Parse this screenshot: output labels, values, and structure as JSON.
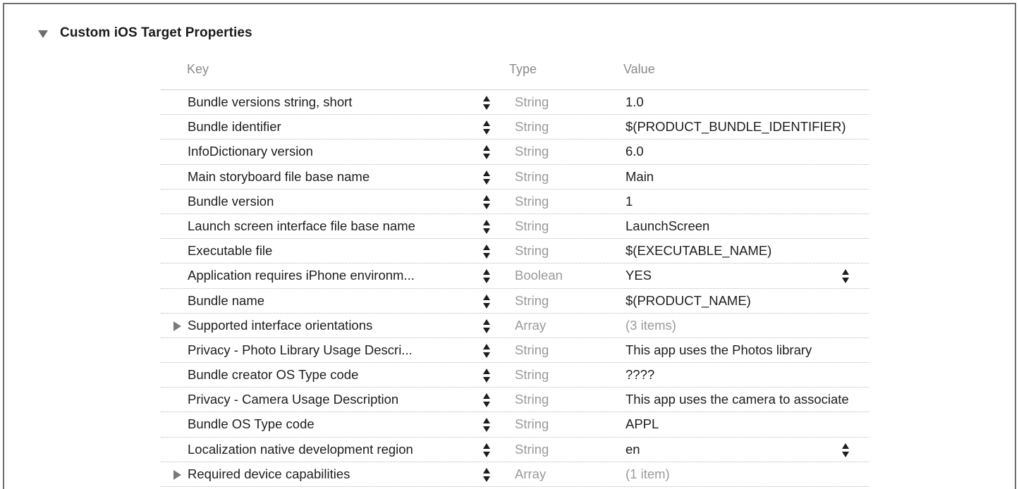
{
  "section": {
    "title": "Custom iOS Target Properties",
    "disclosure_icon": "disclosure-triangle-down-icon"
  },
  "columns": {
    "key": "Key",
    "type": "Type",
    "value": "Value"
  },
  "rows": [
    {
      "key": "Bundle versions string, short",
      "type": "String",
      "value": "1.0",
      "expandable": false,
      "value_popup": false,
      "value_muted": false
    },
    {
      "key": "Bundle identifier",
      "type": "String",
      "value": "$(PRODUCT_BUNDLE_IDENTIFIER)",
      "expandable": false,
      "value_popup": false,
      "value_muted": false
    },
    {
      "key": "InfoDictionary version",
      "type": "String",
      "value": "6.0",
      "expandable": false,
      "value_popup": false,
      "value_muted": false
    },
    {
      "key": "Main storyboard file base name",
      "type": "String",
      "value": "Main",
      "expandable": false,
      "value_popup": false,
      "value_muted": false
    },
    {
      "key": "Bundle version",
      "type": "String",
      "value": "1",
      "expandable": false,
      "value_popup": false,
      "value_muted": false
    },
    {
      "key": "Launch screen interface file base name",
      "type": "String",
      "value": "LaunchScreen",
      "expandable": false,
      "value_popup": false,
      "value_muted": false
    },
    {
      "key": "Executable file",
      "type": "String",
      "value": "$(EXECUTABLE_NAME)",
      "expandable": false,
      "value_popup": false,
      "value_muted": false
    },
    {
      "key": "Application requires iPhone environm...",
      "type": "Boolean",
      "value": "YES",
      "expandable": false,
      "value_popup": true,
      "value_muted": false
    },
    {
      "key": "Bundle name",
      "type": "String",
      "value": "$(PRODUCT_NAME)",
      "expandable": false,
      "value_popup": false,
      "value_muted": false
    },
    {
      "key": "Supported interface orientations",
      "type": "Array",
      "value": "(3 items)",
      "expandable": true,
      "value_popup": false,
      "value_muted": true
    },
    {
      "key": "Privacy - Photo Library Usage Descri...",
      "type": "String",
      "value": "This app uses the Photos library",
      "expandable": false,
      "value_popup": false,
      "value_muted": false
    },
    {
      "key": "Bundle creator OS Type code",
      "type": "String",
      "value": "????",
      "expandable": false,
      "value_popup": false,
      "value_muted": false
    },
    {
      "key": "Privacy - Camera Usage Description",
      "type": "String",
      "value": "This app uses the camera to associate",
      "expandable": false,
      "value_popup": false,
      "value_muted": false
    },
    {
      "key": "Bundle OS Type code",
      "type": "String",
      "value": "APPL",
      "expandable": false,
      "value_popup": false,
      "value_muted": false
    },
    {
      "key": "Localization native development region",
      "type": "String",
      "value": "en",
      "expandable": false,
      "value_popup": true,
      "value_muted": false
    },
    {
      "key": "Required device capabilities",
      "type": "Array",
      "value": "(1 item)",
      "expandable": true,
      "value_popup": false,
      "value_muted": true
    }
  ]
}
